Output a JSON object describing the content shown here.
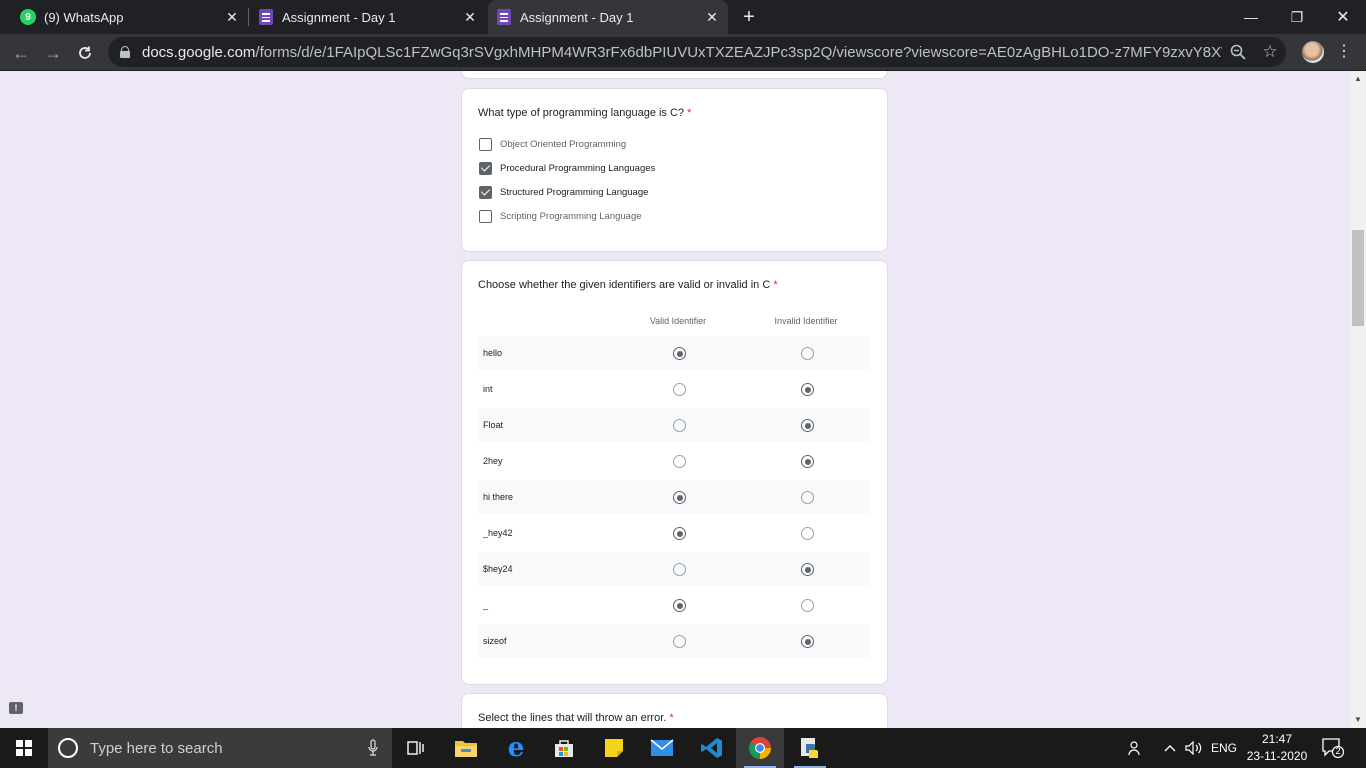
{
  "browser": {
    "tabs": [
      {
        "title": "(9) WhatsApp",
        "badge": "9",
        "icon": "whatsapp-icon"
      },
      {
        "title": "Assignment - Day 1",
        "icon": "google-forms-icon"
      },
      {
        "title": "Assignment - Day 1",
        "icon": "google-forms-icon",
        "active": true
      }
    ],
    "url_host": "docs.google.com",
    "url_path": "/forms/d/e/1FAIpQLSc1FZwGq3rSVgxhMHPM4WR3rFx6dbPIUVUxTXZEAZJPc3sp2Q/viewscore?viewscore=AE0zAgBHLo1DO-z7MFY9zxvY8XWhELTAjRj4Xj7B..."
  },
  "form": {
    "q1": {
      "title": "What type of programming language is C?",
      "required": "*",
      "options": [
        {
          "label": "Object Oriented Programming",
          "checked": false
        },
        {
          "label": "Procedural Programming Languages",
          "checked": true
        },
        {
          "label": "Structured Programming Language",
          "checked": true
        },
        {
          "label": "Scripting Programming Language",
          "checked": false
        }
      ]
    },
    "q2": {
      "title": "Choose whether the given identifiers are valid or invalid in C",
      "required": "*",
      "columns": [
        "Valid Identifier",
        "Invalid Identifier"
      ],
      "rows": [
        {
          "label": "hello",
          "selected": "Valid Identifier"
        },
        {
          "label": "int",
          "selected": "Invalid Identifier"
        },
        {
          "label": "Float",
          "selected": "Invalid Identifier"
        },
        {
          "label": "2hey",
          "selected": "Invalid Identifier"
        },
        {
          "label": "hi there",
          "selected": "Valid Identifier"
        },
        {
          "label": "_hey42",
          "selected": "Valid Identifier"
        },
        {
          "label": "$hey24",
          "selected": "Invalid Identifier"
        },
        {
          "label": "_",
          "selected": "Valid Identifier"
        },
        {
          "label": "sizeof",
          "selected": "Invalid Identifier"
        }
      ]
    },
    "q3": {
      "title": "Select the lines that will throw an error.",
      "required": "*"
    }
  },
  "taskbar": {
    "search_placeholder": "Type here to search",
    "language": "ENG",
    "time": "21:47",
    "date": "23-11-2020",
    "notification_count": "2",
    "apps": [
      "task-view-icon",
      "file-explorer-icon",
      "edge-icon",
      "store-icon",
      "sticky-notes-icon",
      "mail-icon",
      "vscode-icon",
      "chrome-icon",
      "python-icon"
    ]
  },
  "colors": {
    "form_background": "#ede7f6",
    "required": "#d93025",
    "forms_purple": "#7248b9",
    "taskbar": "#1a1a1a"
  }
}
